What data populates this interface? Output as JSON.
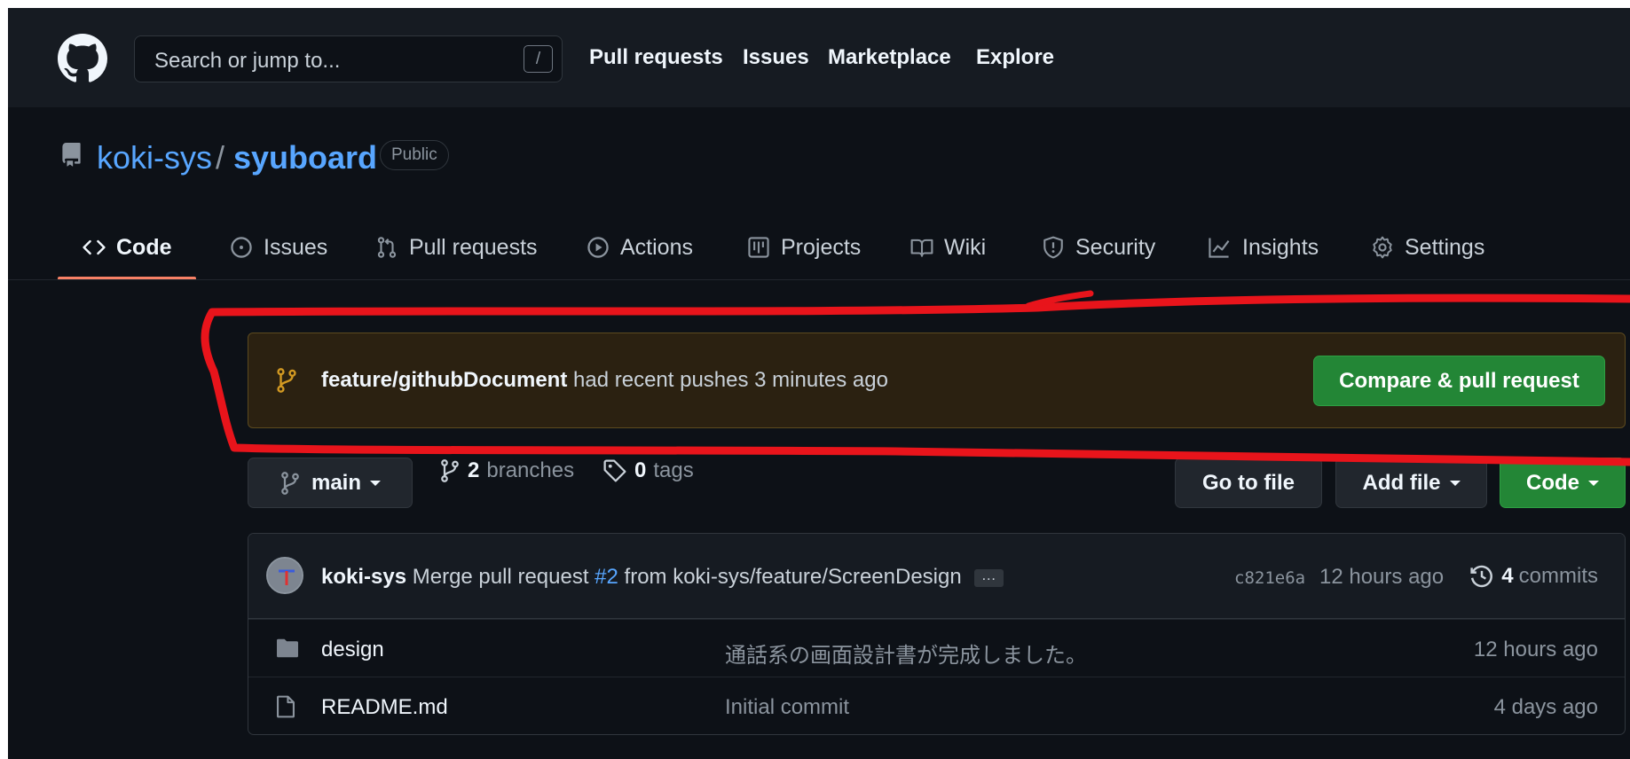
{
  "header": {
    "search_placeholder": "Search or jump to...",
    "search_shortcut": "/",
    "nav": [
      "Pull requests",
      "Issues",
      "Marketplace",
      "Explore"
    ]
  },
  "repo": {
    "owner": "koki-sys",
    "separator": "/",
    "name": "syuboard",
    "visibility": "Public"
  },
  "tabs": [
    {
      "label": "Code",
      "icon": "code-icon",
      "active": true
    },
    {
      "label": "Issues",
      "icon": "issue-opened-icon"
    },
    {
      "label": "Pull requests",
      "icon": "git-pull-request-icon"
    },
    {
      "label": "Actions",
      "icon": "play-icon"
    },
    {
      "label": "Projects",
      "icon": "table-icon"
    },
    {
      "label": "Wiki",
      "icon": "book-icon"
    },
    {
      "label": "Security",
      "icon": "shield-icon"
    },
    {
      "label": "Insights",
      "icon": "graph-icon"
    },
    {
      "label": "Settings",
      "icon": "gear-icon"
    }
  ],
  "banner": {
    "branch": "feature/githubDocument",
    "message": " had recent pushes 3 minutes ago",
    "button": "Compare & pull request"
  },
  "branch_bar": {
    "current_branch": "main",
    "branches_count": "2",
    "branches_label": "branches",
    "tags_count": "0",
    "tags_label": "tags",
    "go_to_file": "Go to file",
    "add_file": "Add file",
    "code": "Code"
  },
  "latest_commit": {
    "author": "koki-sys",
    "message_prefix": " Merge pull request ",
    "pr_ref": "#2",
    "message_suffix": " from koki-sys/feature/ScreenDesign",
    "ellipsis": "…",
    "sha": "c821e6a",
    "time": "12 hours ago",
    "commits_count": "4",
    "commits_label": "commits"
  },
  "files": [
    {
      "type": "folder",
      "name": "design",
      "message": "通話系の画面設計書が完成しました。",
      "age": "12 hours ago"
    },
    {
      "type": "file",
      "name": "README.md",
      "message": "Initial commit",
      "age": "4 days ago"
    }
  ],
  "colors": {
    "background": "#0d1117",
    "header": "#161b22",
    "link": "#58a6ff",
    "accent_underline": "#f78166",
    "primary_button": "#238636",
    "banner_bg": "#2b2111",
    "annotation": "#e8141b"
  }
}
